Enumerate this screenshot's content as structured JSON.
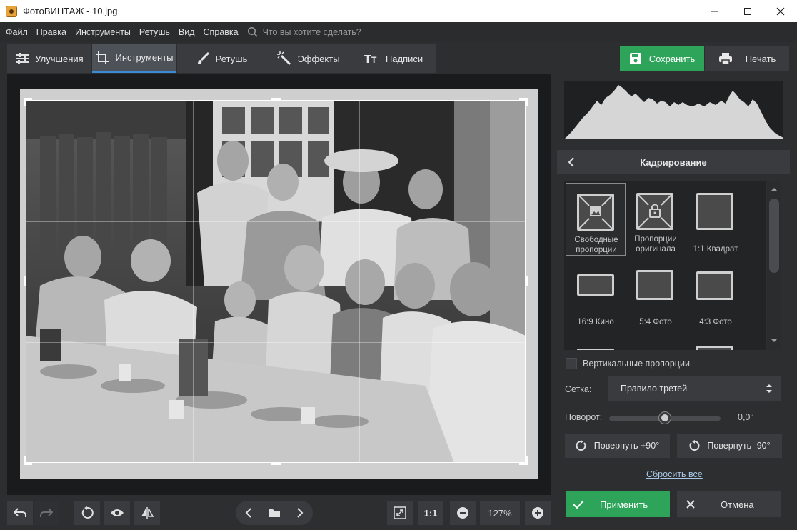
{
  "window": {
    "title": "ФотоВИНТАЖ - 10.jpg"
  },
  "menu": {
    "items": [
      "Файл",
      "Правка",
      "Инструменты",
      "Ретушь",
      "Вид",
      "Справка"
    ],
    "search_placeholder": "Что вы хотите сделать?"
  },
  "tabs": [
    {
      "label": "Улучшения",
      "icon": "sliders-icon"
    },
    {
      "label": "Инструменты",
      "icon": "crop-icon",
      "active": true
    },
    {
      "label": "Ретушь",
      "icon": "brush-icon"
    },
    {
      "label": "Эффекты",
      "icon": "magic-wand-icon"
    },
    {
      "label": "Надписи",
      "icon": "text-icon"
    }
  ],
  "toolbar": {
    "save_label": "Сохранить",
    "print_label": "Печать"
  },
  "colors": {
    "accent_green": "#2ea35a",
    "active_tab_underline": "#3a8cd6",
    "panel_bg": "#2d2e30"
  },
  "crop_panel": {
    "title": "Кадрирование",
    "presets": [
      {
        "label": "Свободные пропорции",
        "line1": "Свободные",
        "line2": "пропорции",
        "icon": "free-crop-icon",
        "selected": true
      },
      {
        "label": "Пропорции оригинала",
        "line1": "Пропорции",
        "line2": "оригинала",
        "icon": "lock-crop-icon"
      },
      {
        "label": "1:1 Квадрат",
        "icon": "square-icon"
      },
      {
        "label": "16:9 Кино",
        "icon": "widescreen-icon"
      },
      {
        "label": "5:4 Фото",
        "icon": "photo-54-icon"
      },
      {
        "label": "4:3 Фото",
        "icon": "photo-43-icon"
      }
    ],
    "vertical_label": "Вертикальные пропорции",
    "vertical_checked": false,
    "grid_label": "Сетка:",
    "grid_value": "Правило третей",
    "rotation_label": "Поворот:",
    "rotation_value": "0,0°",
    "rotation_level": 0.5,
    "rotate_plus_label": "Повернуть +90°",
    "rotate_minus_label": "Повернуть -90°",
    "reset_label": "Сбросить все",
    "apply_label": "Применить",
    "cancel_label": "Отмена"
  },
  "bottom": {
    "fit_label": "1:1",
    "zoom": "127%"
  }
}
